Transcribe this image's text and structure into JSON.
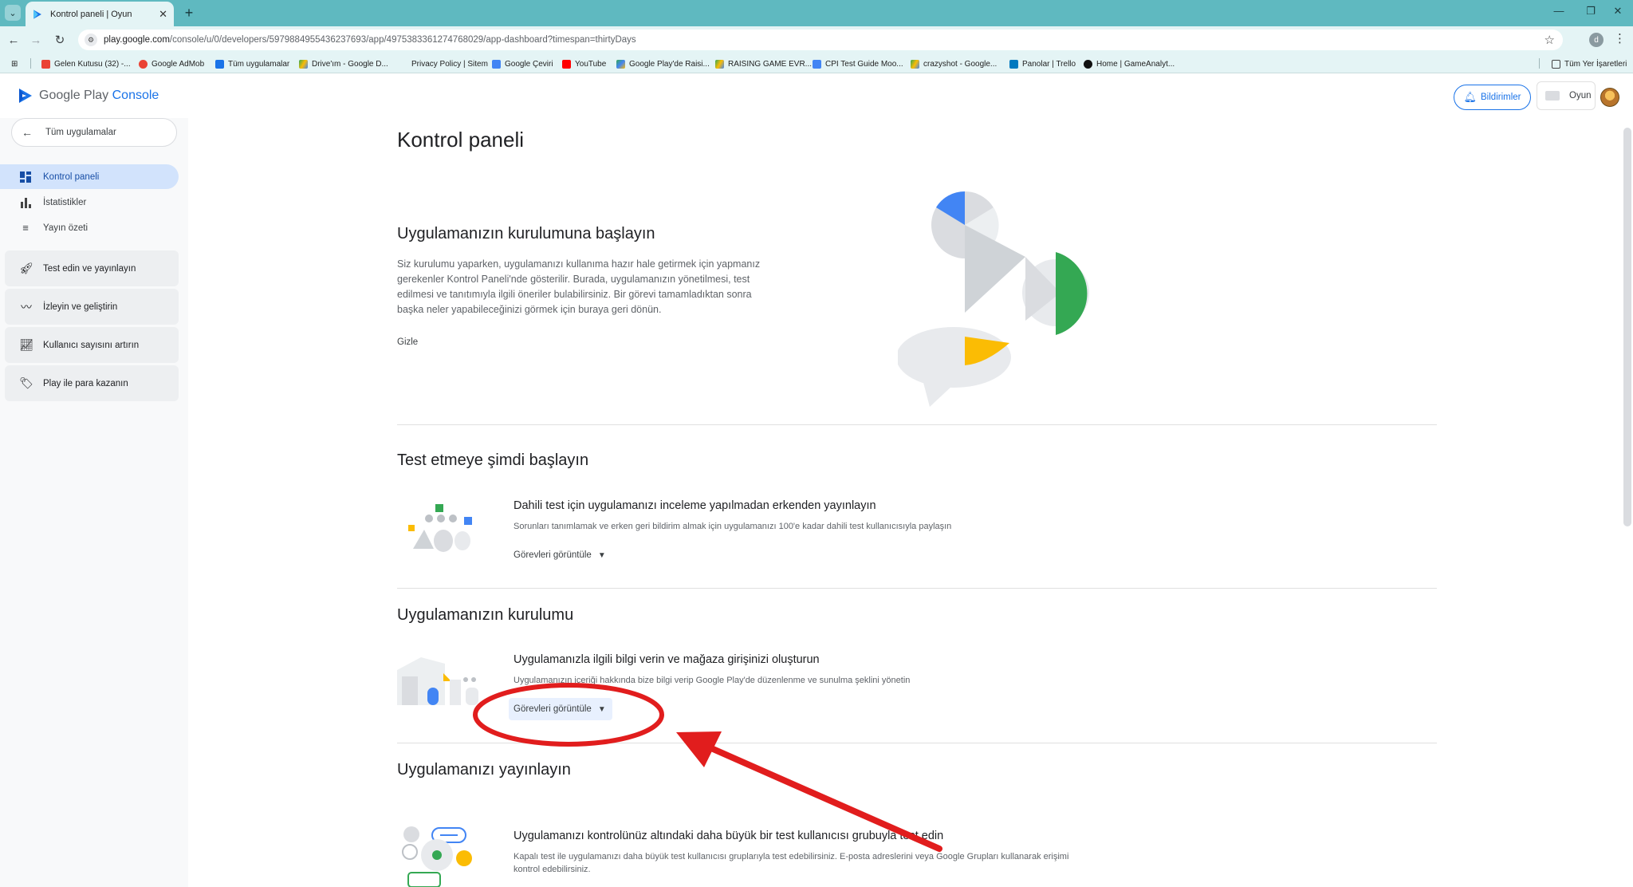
{
  "browser": {
    "tab_title": "Kontrol paneli | Oyun",
    "url_host": "play.google.com",
    "url_path": "/console/u/0/developers/5979884955436237693/app/4975383361274768029/app-dashboard?timespan=thirtyDays",
    "profile_initial": "d",
    "bookmarks": [
      "Gelen Kutusu (32) -...",
      "Google AdMob",
      "Tüm uygulamalar",
      "Drive'ım - Google D...",
      "Privacy Policy | Sitem",
      "Google Çeviri",
      "YouTube",
      "Google Play'de Raisi...",
      "RAISING GAME EVR...",
      "CPI Test Guide Moo...",
      "crazyshot - Google...",
      "Panolar | Trello",
      "Home | GameAnalyt..."
    ],
    "all_bookmarks": "Tüm Yer İşaretleri"
  },
  "header": {
    "logo_prefix": "Google Play",
    "logo_suffix": "Console",
    "notifications": "Bildirimler",
    "app_name": "Oyun"
  },
  "sidebar": {
    "back_label": "Tüm uygulamalar",
    "items": [
      "Kontrol paneli",
      "İstatistikler",
      "Yayın özeti"
    ],
    "groups": [
      "Test edin ve yayınlayın",
      "İzleyin ve geliştirin",
      "Kullanıcı sayısını artırın",
      "Play ile para kazanın"
    ]
  },
  "main": {
    "page_title": "Kontrol paneli",
    "setup": {
      "title": "Uygulamanızın kurulumuna başlayın",
      "description": "Siz kurulumu yaparken, uygulamanızı kullanıma hazır hale getirmek için yapmanız gerekenler Kontrol Paneli'nde gösterilir. Burada, uygulamanızın yönetilmesi, test edilmesi ve tanıtımıyla ilgili öneriler bulabilirsiniz. Bir görevi tamamladıktan sonra başka neler yapabileceğinizi görmek için buraya geri dönün.",
      "hide": "Gizle"
    },
    "sections": [
      {
        "title": "Test etmeye şimdi başlayın",
        "task_title": "Dahili test için uygulamanızı inceleme yapılmadan erkenden yayınlayın",
        "task_desc": "Sorunları tanımlamak ve erken geri bildirim almak için uygulamanızı 100'e kadar dahili test kullanıcısıyla paylaşın",
        "button": "Görevleri görüntüle"
      },
      {
        "title": "Uygulamanızın kurulumu",
        "task_title": "Uygulamanızla ilgili bilgi verin ve mağaza girişinizi oluşturun",
        "task_desc": "Uygulamanızın içeriği hakkında bize bilgi verip Google Play'de düzenlenme ve sunulma şeklini yönetin",
        "button": "Görevleri görüntüle"
      },
      {
        "title": "Uygulamanızı yayınlayın",
        "task_title": "Uygulamanızı kontrolünüz altındaki daha büyük bir test kullanıcısı grubuyla test edin",
        "task_desc": "Kapalı test ile uygulamanızı daha büyük test kullanıcısı gruplarıyla test edebilirsiniz. E-posta adreslerini veya Google Grupları kullanarak erişimi kontrol edebilirsiniz."
      }
    ]
  },
  "colors": {
    "accent": "#1a73e8",
    "active_nav": "#d2e3fc",
    "annotation": "#e11d1d",
    "illus_blue": "#4285f4",
    "illus_green": "#34a853",
    "illus_yellow": "#fbbc04"
  }
}
